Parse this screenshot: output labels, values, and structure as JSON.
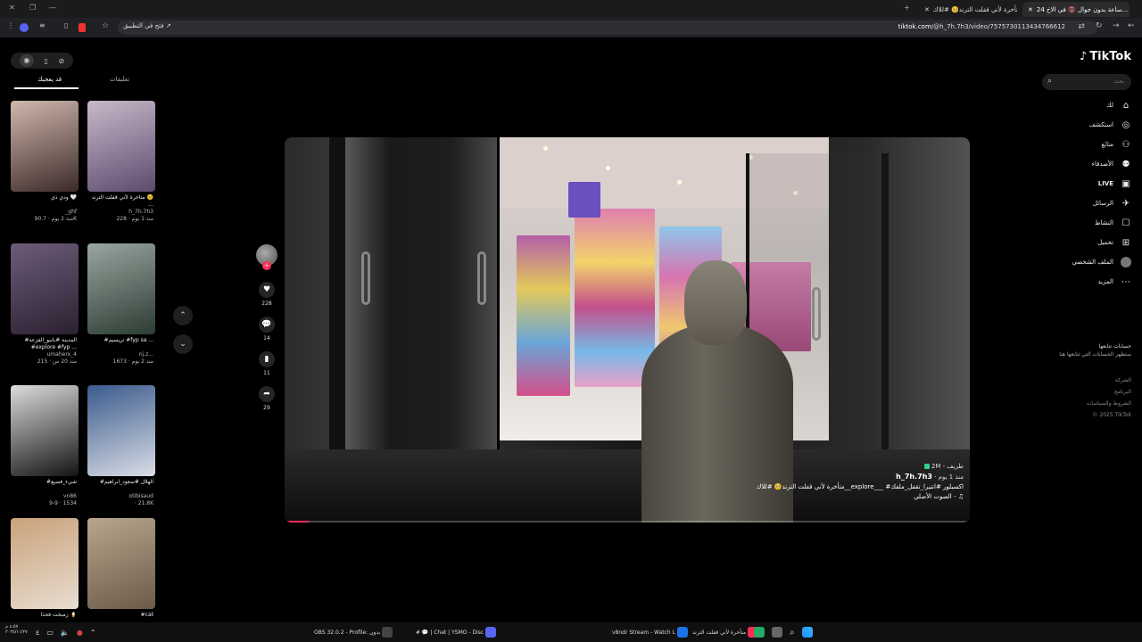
{
  "browser": {
    "tabs": [
      {
        "label": "24 ساعة بدون جوال 📵 في الاخ..."
      },
      {
        "label": "متأخرة لأني قفلت الترند🥺 #للاك..."
      }
    ],
    "open_in_app": "فتح في التطبيق",
    "url_host": "tiktok.com",
    "url_path": "/@h_7h.7h3/video/7575730113434766612"
  },
  "sidebar": {
    "logo": "TikTok",
    "search_placeholder": "بحث",
    "nav": [
      {
        "label": "لك",
        "icon": "home-icon"
      },
      {
        "label": "استكشف",
        "icon": "compass-icon"
      },
      {
        "label": "متابَع",
        "icon": "following-icon"
      },
      {
        "label": "الأصدقاء",
        "icon": "friends-icon"
      },
      {
        "label": "LIVE",
        "icon": "live-icon"
      },
      {
        "label": "الرسائل",
        "icon": "messages-icon"
      },
      {
        "label": "النشاط",
        "icon": "activity-icon"
      },
      {
        "label": "تحميل",
        "icon": "upload-icon"
      },
      {
        "label": "الملف الشخصي",
        "icon": "profile-avatar"
      },
      {
        "label": "المزيد",
        "icon": "more-icon"
      }
    ],
    "following_title": "حسابات تتابعها",
    "following_sub": "ستظهر الحسابات التي تتابعها هنا",
    "footer": [
      "الشركة",
      "البرنامج",
      "الشروط والسياسات",
      "© 2025 TikTok"
    ]
  },
  "video": {
    "username": "h_7h.7h3",
    "posted": "منذ 1 يوم",
    "caption": "متأخرة لأني قفلت الترند🥺 #للاك__explore___ #اكسبلور #انتيرا_تقفل_ملفك",
    "sound": "الصوت الأصلي -",
    "tag_label": "2M - طريف",
    "progress": 0.035
  },
  "actions": {
    "likes": "228",
    "comments": "14",
    "saves": "11",
    "shares": "29"
  },
  "feed": {
    "tabs": [
      "قد يعجبك",
      "تعليقات"
    ],
    "cards": [
      {
        "caption": "متأخرة لأني قفلت الترند 🥺 ...",
        "user": "h_7h.7h3",
        "likes": "228",
        "age": "منذ 1 يوم",
        "colors": [
          "#c7b9c9",
          "#5d4a6e"
        ]
      },
      {
        "caption": "ودي ذي 🤍",
        "user": "_ghf",
        "likes": "90.7K",
        "age": "منذ 2 يوم",
        "colors": [
          "#d1b8ad",
          "#3b2a28"
        ]
      },
      {
        "caption": "#تريسيم #fyp sa ...",
        "user": "nj.z...",
        "likes": "1673",
        "age": "منذ 2 يوم",
        "colors": [
          "#9aa6a0",
          "#2b3c33"
        ]
      },
      {
        "caption": "#المدينة #بانيو_الفزعه #explore #fyp ...",
        "user": "umaherx_4",
        "likes": "215",
        "age": "منذ 20 س",
        "colors": [
          "#6d5c7a",
          "#2b2030"
        ]
      },
      {
        "caption": "#الهلال #سعود_ابراهيم",
        "user": "otibisaud",
        "likes": "21.8K",
        "age": "",
        "colors": [
          "#3a5a8c",
          "#d9dde6"
        ]
      },
      {
        "caption": "#شيء_فضيع",
        "user": "vn86",
        "likes": "1534",
        "age": "9-9",
        "colors": [
          "#dcdcdc",
          "#141414"
        ]
      },
      {
        "caption": "#cat",
        "user": "",
        "likes": "",
        "age": "",
        "colors": [
          "#b8a78e",
          "#6a5a48"
        ]
      },
      {
        "caption": "زمبخت فحذاً 🍦",
        "user": "",
        "likes": "",
        "age": "",
        "colors": [
          "#c9a27a",
          "#e8ddd1"
        ]
      }
    ]
  },
  "taskbar": {
    "time": "٤:٥٧ م",
    "date": "٢٠٢٥/١١/٢٧",
    "apps": [
      {
        "label": "OBS 32.0.2 - Profile: بدون",
        "color": "#444"
      },
      {
        "label": "# 💬 | Chat | YSMO - Disc",
        "color": "#5865f2"
      },
      {
        "label": "v8ndr Stream - Watch L",
        "color": "#1a73e8"
      },
      {
        "label": "متأخرة لأني قفلت الترند",
        "color": "#fe2c55"
      }
    ]
  }
}
